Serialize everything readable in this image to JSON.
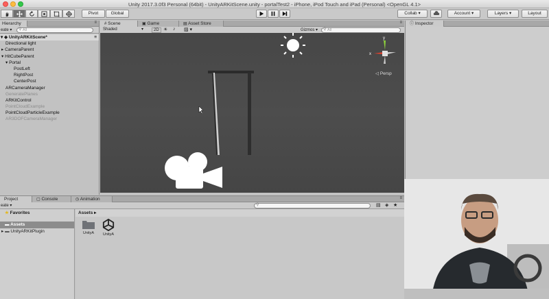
{
  "window": {
    "title": "Unity 2017.3.0f3 Personal (64bit) - UnityARKitScene.unity - portalTest2 - iPhone, iPod Touch and iPad (Personal) <OpenGL 4.1>"
  },
  "toolbar": {
    "pivot_label": "Pivot",
    "global_label": "Global",
    "collab_label": "Collab ▾",
    "account_label": "Account ▾",
    "layers_label": "Layers ▾",
    "layout_label": "Layout"
  },
  "hierarchy": {
    "tab_label": "Hierarchy",
    "create_label": "eate ▾",
    "search_placeholder": "All",
    "root": "UnityARKitScene*",
    "items": [
      {
        "label": "Directional light",
        "indent": 1,
        "disabled": false
      },
      {
        "label": "CameraParent",
        "indent": 0,
        "disabled": false,
        "arrow": "▸"
      },
      {
        "label": "HitCubeParent",
        "indent": 0,
        "disabled": false,
        "arrow": "▾"
      },
      {
        "label": "Portal",
        "indent": 1,
        "disabled": false,
        "arrow": "▾"
      },
      {
        "label": "PostLeft",
        "indent": 3,
        "disabled": false
      },
      {
        "label": "RightPost",
        "indent": 3,
        "disabled": false
      },
      {
        "label": "CenterPost",
        "indent": 3,
        "disabled": false
      },
      {
        "label": "ARCameraManager",
        "indent": 1,
        "disabled": false
      },
      {
        "label": "GeneratePlanes",
        "indent": 1,
        "disabled": true
      },
      {
        "label": "ARKitControl",
        "indent": 1,
        "disabled": false
      },
      {
        "label": "PointCloudExample",
        "indent": 1,
        "disabled": true
      },
      {
        "label": "PointCloudParticleExample",
        "indent": 1,
        "disabled": false
      },
      {
        "label": "AR3DOFCameraManager",
        "indent": 1,
        "disabled": true
      }
    ]
  },
  "scene": {
    "tabs": [
      {
        "label": "Scene",
        "icon": "scene-icon"
      },
      {
        "label": "Game",
        "icon": "game-icon"
      },
      {
        "label": "Asset Store",
        "icon": "store-icon"
      }
    ],
    "shading_mode": "Shaded",
    "mode_2d": "2D",
    "gizmos_label": "Gizmos ▾",
    "search_placeholder": "All",
    "persp_label": "Persp",
    "gizmo_x": "x",
    "gizmo_y": "y"
  },
  "inspector": {
    "tab_label": "Inspector"
  },
  "project": {
    "tabs": [
      {
        "label": "Project"
      },
      {
        "label": "Console"
      },
      {
        "label": "Animation"
      }
    ],
    "create_label": "eate ▾",
    "favorites_label": "Favorites",
    "assets_label": "Assets",
    "tree_item": "UnityARKitPlugin",
    "breadcrumb": "Assets ▸",
    "assets": [
      {
        "name": "UnityA",
        "icon": "folder-icon"
      },
      {
        "name": "UnityA",
        "icon": "unity-scene-icon"
      }
    ]
  },
  "colors": {
    "scene_bg": "#484848",
    "panel_bg": "#c2c2c2",
    "selected_tool": "#6f6f6f"
  }
}
